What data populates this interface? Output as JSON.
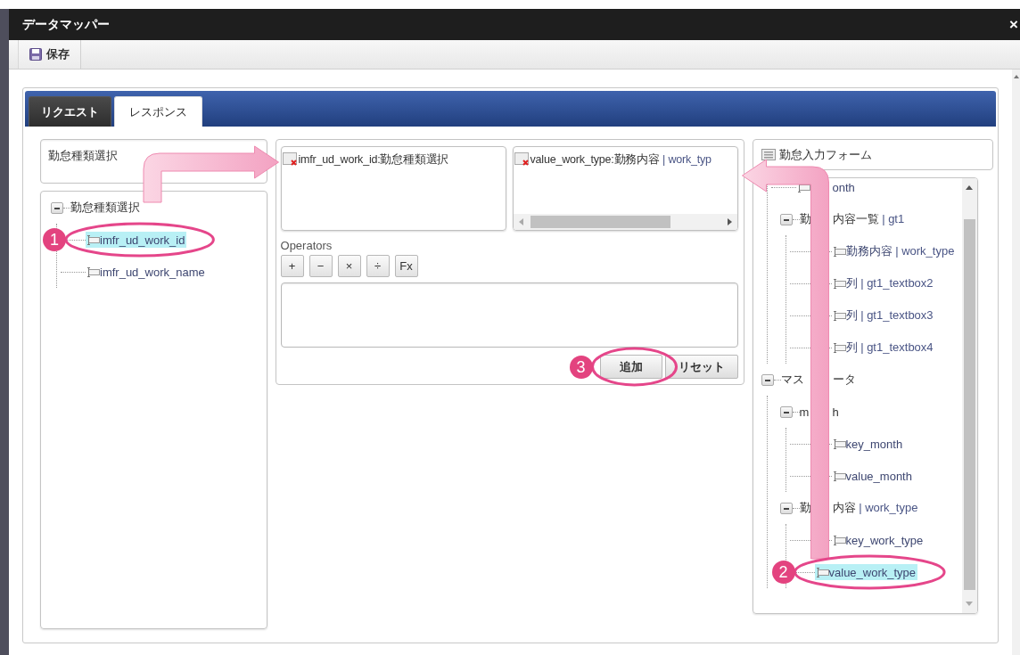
{
  "window": {
    "title": "データマッパー",
    "close": "×"
  },
  "toolbar": {
    "save": "保存"
  },
  "tabs": [
    {
      "label": "リクエスト",
      "selected": false
    },
    {
      "label": "レスポンス",
      "selected": true
    }
  ],
  "source": {
    "field_value": "勤怠種類選択",
    "tree": [
      {
        "kind": "group",
        "expanded": true,
        "selected": false,
        "label": [
          "勤怠種類選択"
        ],
        "children": [
          {
            "kind": "leaf",
            "selected": true,
            "label": [
              "imfr_ud_work_id"
            ]
          },
          {
            "kind": "leaf",
            "selected": false,
            "label": [
              "imfr_ud_work_name"
            ]
          }
        ]
      }
    ]
  },
  "mapping": {
    "slots": [
      {
        "text": "imfr_ud_work_id:勤怠種類選択"
      },
      {
        "text": "value_work_type:勤務内容",
        "suffix": "| work_typ",
        "scrollable": true
      }
    ],
    "operators_label": "Operators",
    "operators": [
      "+",
      "−",
      "×",
      "÷",
      "Fx"
    ],
    "add_button": "追加",
    "reset_button": "リセット"
  },
  "target": {
    "title": "勤怠入力フォーム",
    "tree": [
      {
        "kind": "continued",
        "children": [
          {
            "kind": "leaf",
            "selected": false,
            "gap_before": true,
            "label": [
              "onth"
            ]
          },
          {
            "kind": "group",
            "expanded": true,
            "selected": false,
            "label": [
              "勤",
              "内容一覧"
            ],
            "suffix": "| gt1",
            "children": [
              {
                "kind": "leaf",
                "selected": false,
                "label": [
                  "勤務内容"
                ],
                "suffix": "| work_type"
              },
              {
                "kind": "leaf",
                "selected": false,
                "label": [
                  "列"
                ],
                "suffix": "| gt1_textbox2"
              },
              {
                "kind": "leaf",
                "selected": false,
                "label": [
                  "列"
                ],
                "suffix": "| gt1_textbox3"
              },
              {
                "kind": "leaf",
                "selected": false,
                "label": [
                  "列"
                ],
                "suffix": "| gt1_textbox4"
              }
            ]
          }
        ]
      },
      {
        "kind": "group",
        "expanded": true,
        "selected": false,
        "label": [
          "マス",
          "ータ"
        ],
        "children": [
          {
            "kind": "group",
            "expanded": true,
            "selected": false,
            "label": [
              "m",
              "h"
            ],
            "children": [
              {
                "kind": "leaf",
                "selected": false,
                "label": [
                  "key_month"
                ]
              },
              {
                "kind": "leaf",
                "selected": false,
                "label": [
                  "value_month"
                ]
              }
            ]
          },
          {
            "kind": "group",
            "expanded": true,
            "selected": false,
            "label": [
              "勤",
              "内容"
            ],
            "suffix": "| work_type",
            "children": [
              {
                "kind": "leaf",
                "selected": false,
                "label": [
                  "key_work_type"
                ]
              },
              {
                "kind": "leaf",
                "selected": true,
                "label": [
                  "value_work_type"
                ]
              }
            ]
          }
        ]
      }
    ]
  },
  "annotations": [
    {
      "number": "1"
    },
    {
      "number": "2"
    },
    {
      "number": "3"
    }
  ]
}
